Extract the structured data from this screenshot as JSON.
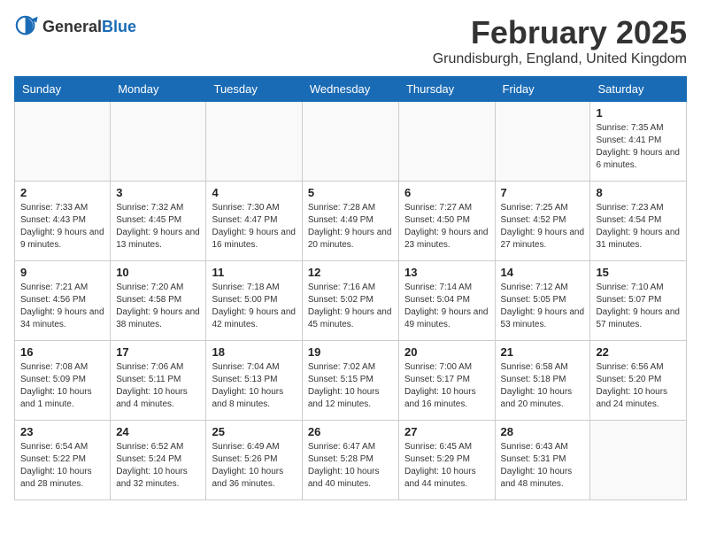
{
  "logo": {
    "general": "General",
    "blue": "Blue"
  },
  "title": "February 2025",
  "location": "Grundisburgh, England, United Kingdom",
  "weekdays": [
    "Sunday",
    "Monday",
    "Tuesday",
    "Wednesday",
    "Thursday",
    "Friday",
    "Saturday"
  ],
  "weeks": [
    [
      {
        "day": "",
        "info": ""
      },
      {
        "day": "",
        "info": ""
      },
      {
        "day": "",
        "info": ""
      },
      {
        "day": "",
        "info": ""
      },
      {
        "day": "",
        "info": ""
      },
      {
        "day": "",
        "info": ""
      },
      {
        "day": "1",
        "info": "Sunrise: 7:35 AM\nSunset: 4:41 PM\nDaylight: 9 hours and 6 minutes."
      }
    ],
    [
      {
        "day": "2",
        "info": "Sunrise: 7:33 AM\nSunset: 4:43 PM\nDaylight: 9 hours and 9 minutes."
      },
      {
        "day": "3",
        "info": "Sunrise: 7:32 AM\nSunset: 4:45 PM\nDaylight: 9 hours and 13 minutes."
      },
      {
        "day": "4",
        "info": "Sunrise: 7:30 AM\nSunset: 4:47 PM\nDaylight: 9 hours and 16 minutes."
      },
      {
        "day": "5",
        "info": "Sunrise: 7:28 AM\nSunset: 4:49 PM\nDaylight: 9 hours and 20 minutes."
      },
      {
        "day": "6",
        "info": "Sunrise: 7:27 AM\nSunset: 4:50 PM\nDaylight: 9 hours and 23 minutes."
      },
      {
        "day": "7",
        "info": "Sunrise: 7:25 AM\nSunset: 4:52 PM\nDaylight: 9 hours and 27 minutes."
      },
      {
        "day": "8",
        "info": "Sunrise: 7:23 AM\nSunset: 4:54 PM\nDaylight: 9 hours and 31 minutes."
      }
    ],
    [
      {
        "day": "9",
        "info": "Sunrise: 7:21 AM\nSunset: 4:56 PM\nDaylight: 9 hours and 34 minutes."
      },
      {
        "day": "10",
        "info": "Sunrise: 7:20 AM\nSunset: 4:58 PM\nDaylight: 9 hours and 38 minutes."
      },
      {
        "day": "11",
        "info": "Sunrise: 7:18 AM\nSunset: 5:00 PM\nDaylight: 9 hours and 42 minutes."
      },
      {
        "day": "12",
        "info": "Sunrise: 7:16 AM\nSunset: 5:02 PM\nDaylight: 9 hours and 45 minutes."
      },
      {
        "day": "13",
        "info": "Sunrise: 7:14 AM\nSunset: 5:04 PM\nDaylight: 9 hours and 49 minutes."
      },
      {
        "day": "14",
        "info": "Sunrise: 7:12 AM\nSunset: 5:05 PM\nDaylight: 9 hours and 53 minutes."
      },
      {
        "day": "15",
        "info": "Sunrise: 7:10 AM\nSunset: 5:07 PM\nDaylight: 9 hours and 57 minutes."
      }
    ],
    [
      {
        "day": "16",
        "info": "Sunrise: 7:08 AM\nSunset: 5:09 PM\nDaylight: 10 hours and 1 minute."
      },
      {
        "day": "17",
        "info": "Sunrise: 7:06 AM\nSunset: 5:11 PM\nDaylight: 10 hours and 4 minutes."
      },
      {
        "day": "18",
        "info": "Sunrise: 7:04 AM\nSunset: 5:13 PM\nDaylight: 10 hours and 8 minutes."
      },
      {
        "day": "19",
        "info": "Sunrise: 7:02 AM\nSunset: 5:15 PM\nDaylight: 10 hours and 12 minutes."
      },
      {
        "day": "20",
        "info": "Sunrise: 7:00 AM\nSunset: 5:17 PM\nDaylight: 10 hours and 16 minutes."
      },
      {
        "day": "21",
        "info": "Sunrise: 6:58 AM\nSunset: 5:18 PM\nDaylight: 10 hours and 20 minutes."
      },
      {
        "day": "22",
        "info": "Sunrise: 6:56 AM\nSunset: 5:20 PM\nDaylight: 10 hours and 24 minutes."
      }
    ],
    [
      {
        "day": "23",
        "info": "Sunrise: 6:54 AM\nSunset: 5:22 PM\nDaylight: 10 hours and 28 minutes."
      },
      {
        "day": "24",
        "info": "Sunrise: 6:52 AM\nSunset: 5:24 PM\nDaylight: 10 hours and 32 minutes."
      },
      {
        "day": "25",
        "info": "Sunrise: 6:49 AM\nSunset: 5:26 PM\nDaylight: 10 hours and 36 minutes."
      },
      {
        "day": "26",
        "info": "Sunrise: 6:47 AM\nSunset: 5:28 PM\nDaylight: 10 hours and 40 minutes."
      },
      {
        "day": "27",
        "info": "Sunrise: 6:45 AM\nSunset: 5:29 PM\nDaylight: 10 hours and 44 minutes."
      },
      {
        "day": "28",
        "info": "Sunrise: 6:43 AM\nSunset: 5:31 PM\nDaylight: 10 hours and 48 minutes."
      },
      {
        "day": "",
        "info": ""
      }
    ]
  ]
}
